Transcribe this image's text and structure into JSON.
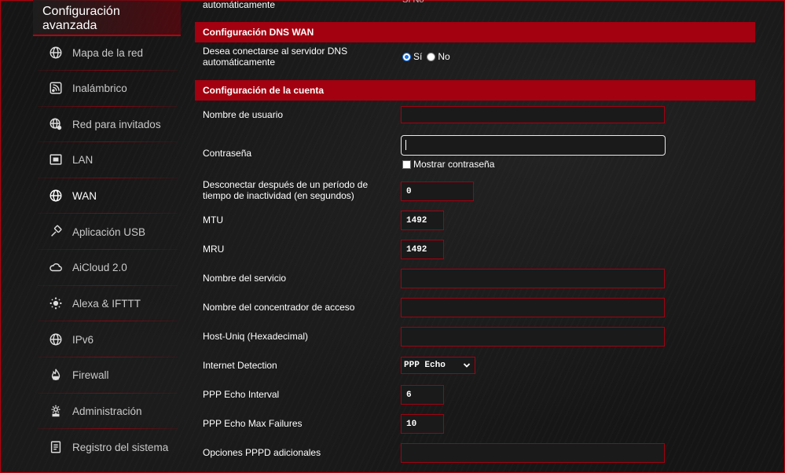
{
  "sidebar": {
    "title": "Configuración avanzada",
    "items": [
      {
        "label": "Mapa de la red",
        "icon": "globe-icon"
      },
      {
        "label": "Inalámbrico",
        "icon": "wireless-icon"
      },
      {
        "label": "Red para invitados",
        "icon": "guest-network-icon"
      },
      {
        "label": "LAN",
        "icon": "lan-icon"
      },
      {
        "label": "WAN",
        "icon": "wan-globe-icon"
      },
      {
        "label": "Aplicación USB",
        "icon": "usb-icon"
      },
      {
        "label": "AiCloud 2.0",
        "icon": "cloud-icon"
      },
      {
        "label": "Alexa & IFTTT",
        "icon": "alexa-icon"
      },
      {
        "label": "IPv6",
        "icon": "ipv6-globe-icon"
      },
      {
        "label": "Firewall",
        "icon": "firewall-icon"
      },
      {
        "label": "Administración",
        "icon": "gear-icon"
      },
      {
        "label": "Registro del sistema",
        "icon": "log-icon"
      }
    ]
  },
  "top_partial": {
    "label": "automáticamente",
    "radio_yes": "Sí",
    "radio_no": "No"
  },
  "dns_section": {
    "title": "Configuración DNS WAN",
    "question": "Desea conectarse al servidor DNS automáticamente",
    "yes_label": "Sí",
    "no_label": "No",
    "selected": "Sí"
  },
  "account_section": {
    "title": "Configuración de la cuenta",
    "username_label": "Nombre de usuario",
    "username_value": "",
    "password_label": "Contraseña",
    "password_value": "",
    "show_password_label": "Mostrar contraseña",
    "idle_label": "Desconectar después de un período de tiempo de inactividad (en segundos)",
    "idle_value": "0",
    "mtu_label": "MTU",
    "mtu_value": "1492",
    "mru_label": "MRU",
    "mru_value": "1492",
    "service_label": "Nombre del servicio",
    "service_value": "",
    "ac_label": "Nombre del concentrador de acceso",
    "ac_value": "",
    "hostuniq_label": "Host-Uniq (Hexadecimal)",
    "hostuniq_value": "",
    "detection_label": "Internet Detection",
    "detection_value": "PPP Echo",
    "echo_interval_label": "PPP Echo Interval",
    "echo_interval_value": "6",
    "echo_failures_label": "PPP Echo Max Failures",
    "echo_failures_value": "10",
    "pppd_label": "Opciones PPPD adicionales",
    "pppd_value": ""
  },
  "colors": {
    "accent": "#a30010",
    "frame": "#b8000e",
    "background": "#151515"
  }
}
